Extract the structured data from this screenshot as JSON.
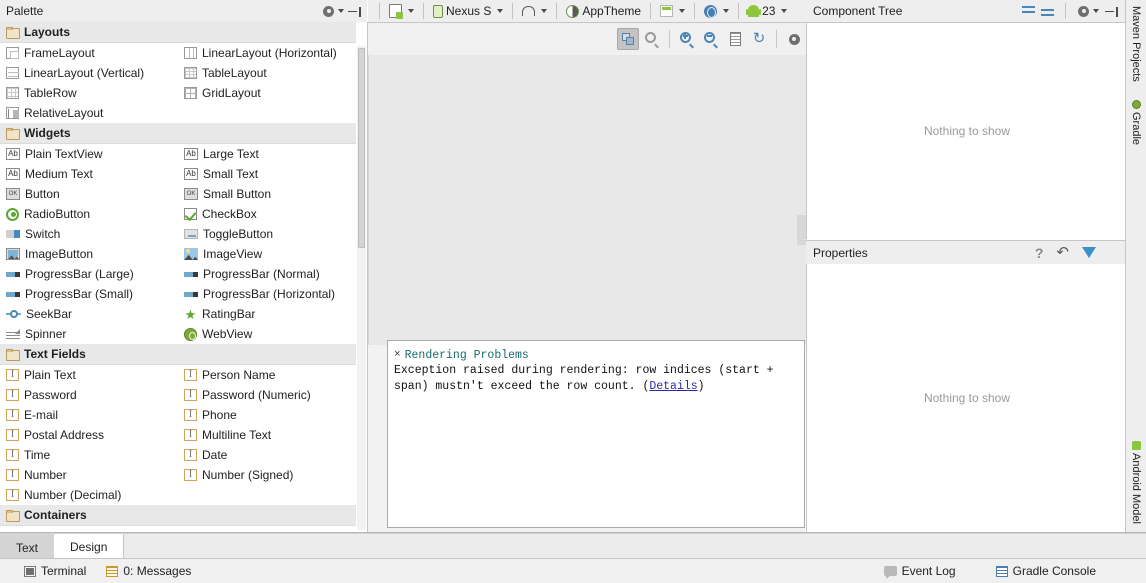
{
  "palette": {
    "title": "Palette",
    "tools": [
      {
        "name": "gear-icon",
        "label": "⚙"
      },
      {
        "name": "collapse-all-icon",
        "label": "⇥"
      }
    ],
    "groups": [
      {
        "name": "Layouts",
        "items": [
          {
            "label": "FrameLayout",
            "icon": "frame-layout-icon"
          },
          {
            "label": "LinearLayout (Horizontal)",
            "icon": "linear-layout-horizontal-icon"
          },
          {
            "label": "LinearLayout (Vertical)",
            "icon": "linear-layout-vertical-icon"
          },
          {
            "label": "TableLayout",
            "icon": "table-layout-icon"
          },
          {
            "label": "TableRow",
            "icon": "table-row-icon"
          },
          {
            "label": "GridLayout",
            "icon": "grid-layout-icon"
          },
          {
            "label": "RelativeLayout",
            "icon": "relative-layout-icon"
          }
        ]
      },
      {
        "name": "Widgets",
        "items": [
          {
            "label": "Plain TextView",
            "icon": "text-ab-icon"
          },
          {
            "label": "Large Text",
            "icon": "text-ab-icon"
          },
          {
            "label": "Medium Text",
            "icon": "text-ab-icon"
          },
          {
            "label": "Small Text",
            "icon": "text-ab-icon"
          },
          {
            "label": "Button",
            "icon": "button-ok-icon"
          },
          {
            "label": "Small Button",
            "icon": "button-ok-icon"
          },
          {
            "label": "RadioButton",
            "icon": "radio-button-icon"
          },
          {
            "label": "CheckBox",
            "icon": "checkbox-icon"
          },
          {
            "label": "Switch",
            "icon": "switch-icon"
          },
          {
            "label": "ToggleButton",
            "icon": "toggle-button-icon"
          },
          {
            "label": "ImageButton",
            "icon": "image-button-icon"
          },
          {
            "label": "ImageView",
            "icon": "image-view-icon"
          },
          {
            "label": "ProgressBar (Large)",
            "icon": "progress-bar-icon"
          },
          {
            "label": "ProgressBar (Normal)",
            "icon": "progress-bar-icon"
          },
          {
            "label": "ProgressBar (Small)",
            "icon": "progress-bar-icon"
          },
          {
            "label": "ProgressBar (Horizontal)",
            "icon": "progress-bar-icon"
          },
          {
            "label": "SeekBar",
            "icon": "seek-bar-icon"
          },
          {
            "label": "RatingBar",
            "icon": "rating-star-icon"
          },
          {
            "label": "Spinner",
            "icon": "spinner-icon"
          },
          {
            "label": "WebView",
            "icon": "web-view-icon"
          }
        ]
      },
      {
        "name": "Text Fields",
        "items": [
          {
            "label": "Plain Text",
            "icon": "edit-text-icon"
          },
          {
            "label": "Person Name",
            "icon": "edit-text-icon"
          },
          {
            "label": "Password",
            "icon": "edit-text-icon"
          },
          {
            "label": "Password (Numeric)",
            "icon": "edit-text-icon"
          },
          {
            "label": "E-mail",
            "icon": "edit-text-icon"
          },
          {
            "label": "Phone",
            "icon": "edit-text-icon"
          },
          {
            "label": "Postal Address",
            "icon": "edit-text-icon"
          },
          {
            "label": "Multiline Text",
            "icon": "edit-text-icon"
          },
          {
            "label": "Time",
            "icon": "edit-text-icon"
          },
          {
            "label": "Date",
            "icon": "edit-text-icon"
          },
          {
            "label": "Number",
            "icon": "edit-text-icon"
          },
          {
            "label": "Number (Signed)",
            "icon": "edit-text-icon"
          },
          {
            "label": "Number (Decimal)",
            "icon": "edit-text-icon"
          }
        ]
      },
      {
        "name": "Containers",
        "items": []
      }
    ]
  },
  "editor_toolbar": {
    "layout_variant": "",
    "device": "Nexus S",
    "orientation": "",
    "theme": "AppTheme",
    "locale": "",
    "ui_mode": "",
    "api_level": "23"
  },
  "design_toolbar": {
    "buttons": [
      {
        "name": "zoom-to-fit-button",
        "label": ""
      },
      {
        "name": "zoom-actual-size-button",
        "label": "1:1"
      },
      {
        "name": "zoom-in-button",
        "label": "+"
      },
      {
        "name": "zoom-out-button",
        "label": "−"
      },
      {
        "name": "show-layout-decorations-button",
        "label": ""
      },
      {
        "name": "refresh-button",
        "label": "↻"
      },
      {
        "name": "settings-button",
        "label": "⚙"
      }
    ]
  },
  "rendering_problems": {
    "close_label": "×",
    "title": "Rendering Problems",
    "message": "Exception raised during rendering: row indices (start + span) mustn't exceed the row count. (",
    "details_link": "Details",
    "message_tail": ")"
  },
  "component_tree": {
    "title": "Component Tree",
    "empty_text": "Nothing to show",
    "tools": [
      {
        "name": "expand-all-icon"
      },
      {
        "name": "collapse-all-icon"
      },
      {
        "name": "gear-icon"
      },
      {
        "name": "hide-panel-icon"
      }
    ]
  },
  "properties": {
    "title": "Properties",
    "empty_text": "Nothing to show",
    "tools": [
      {
        "name": "help-icon",
        "label": "?"
      },
      {
        "name": "restore-default-icon",
        "label": "↶"
      },
      {
        "name": "filter-icon",
        "label": ""
      }
    ]
  },
  "right_tool_strip": {
    "tabs": [
      {
        "label": "Maven Projects",
        "icon": null
      },
      {
        "label": "Gradle",
        "icon": "gradle-icon"
      },
      {
        "label": "Android Model",
        "icon": "android-icon"
      }
    ]
  },
  "bottom_tabs": {
    "tabs": [
      {
        "label": "Text",
        "active": false
      },
      {
        "label": "Design",
        "active": true
      }
    ]
  },
  "status_bar": {
    "left": [
      {
        "label": "Terminal",
        "icon": "terminal-icon"
      },
      {
        "label": "0: Messages",
        "icon": "messages-icon",
        "underline_char": "0"
      }
    ],
    "right": [
      {
        "label": "Event Log",
        "icon": "event-log-icon"
      },
      {
        "label": "Gradle Console",
        "icon": "gradle-console-icon"
      }
    ]
  },
  "colors": {
    "panel_bg": "#eeeeee",
    "content_bg": "#ffffff",
    "canvas_bg": "#e8e8e8",
    "group_header_bg": "#e8e8e8",
    "accent_blue": "#4a86b8",
    "accent_green": "#8cc63e",
    "link": "#2a2aa5",
    "problem_title": "#1a6b6b",
    "muted_text": "#9a9a9a"
  }
}
